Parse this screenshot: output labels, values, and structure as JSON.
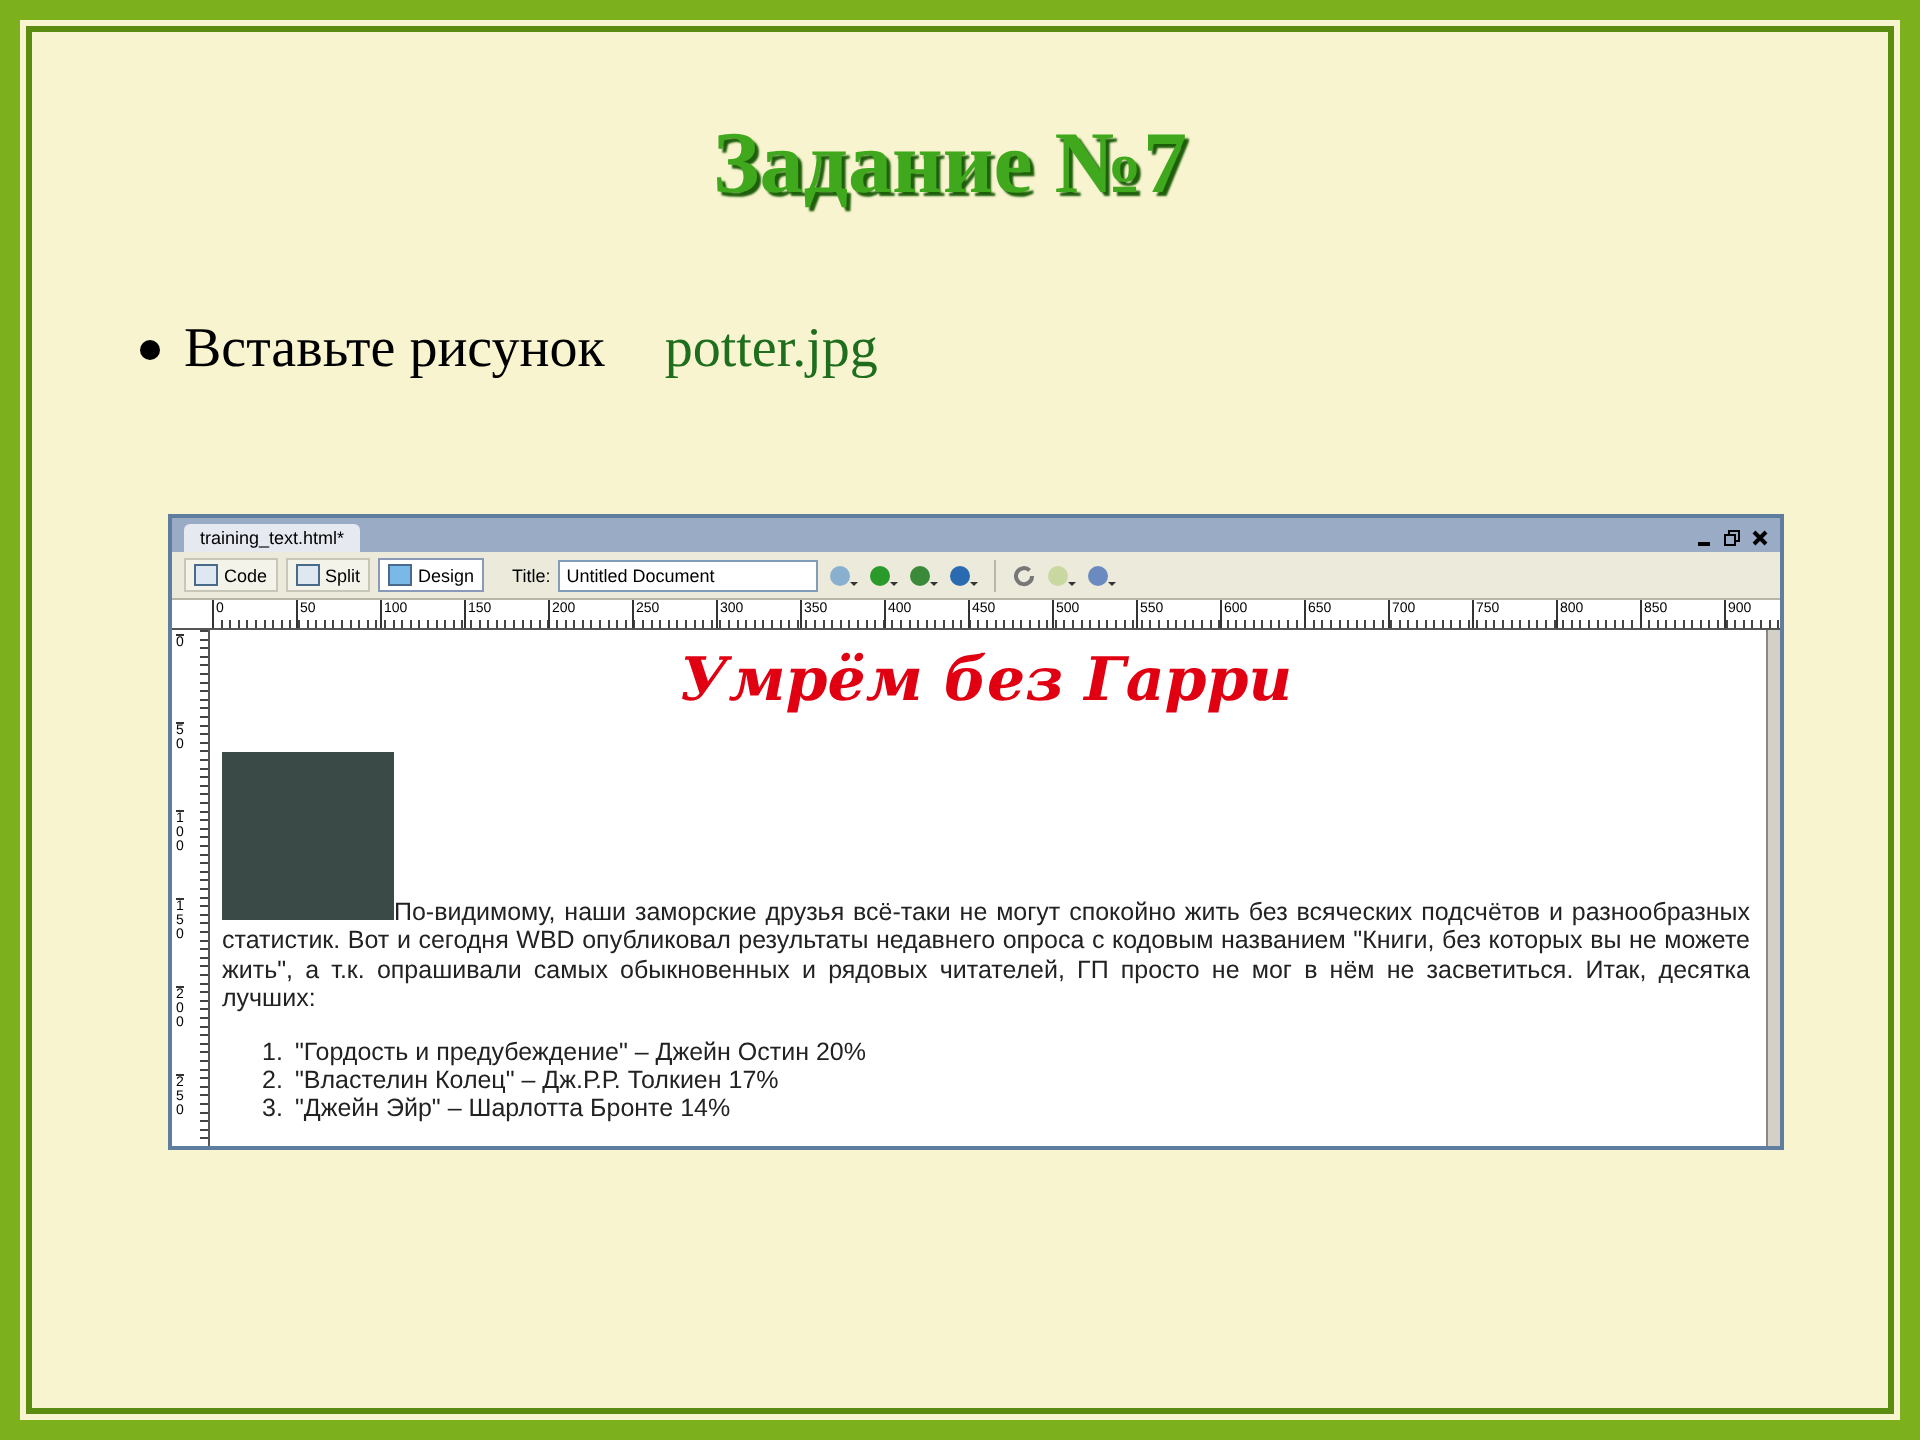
{
  "slide": {
    "title": "Задание №7",
    "bullets": [
      {
        "text": "Вставьте рисунок",
        "file": "potter.jpg"
      }
    ]
  },
  "editor": {
    "tab": "training_text.html*",
    "views": [
      {
        "label": "Code",
        "selected": false
      },
      {
        "label": "Split",
        "selected": false
      },
      {
        "label": "Design",
        "selected": true
      }
    ],
    "title_label": "Title:",
    "title_value": "Untitled Document",
    "ruler_h": [
      "0",
      "50",
      "100",
      "150",
      "200",
      "250",
      "300",
      "350",
      "400",
      "450",
      "500",
      "550",
      "600",
      "650",
      "700",
      "750",
      "800",
      "850",
      "900"
    ],
    "ruler_v": [
      "0",
      "50",
      "100",
      "150",
      "200",
      "250"
    ],
    "page": {
      "heading": "Умрём без Гарри",
      "paragraph": "По-видимому, наши заморские друзья всё-таки не могут спокойно жить без всяческих подсчётов и разнообразных статистик. Вот и сегодня WBD опубликовал результаты недавнего опроса с кодовым названием \"Книги, без которых вы не можете жить\", а т.к. опрашивали самых обыкновенных и рядовых читателей, ГП просто не мог в нём не засветиться. Итак, десятка лучших:",
      "list": [
        {
          "number": "1.",
          "text": "\"Гордость и предубеждение\" – Джейн Остин 20%"
        },
        {
          "number": "2.",
          "text": "\"Властелин Колец\" – Дж.Р.Р. Толкиен 17%"
        },
        {
          "number": "3.",
          "text": "\"Джейн Эйр\" – Шарлотта Бронте 14%"
        }
      ]
    }
  }
}
